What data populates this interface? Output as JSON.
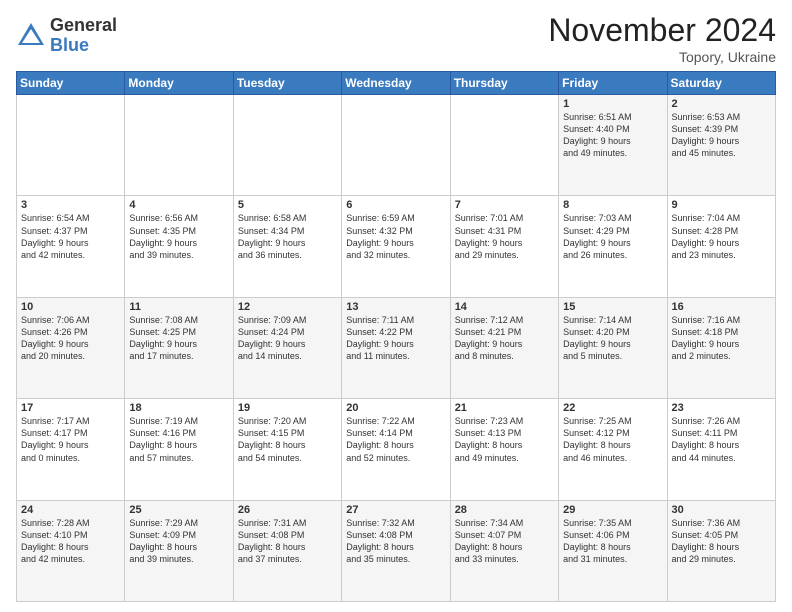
{
  "header": {
    "logo_general": "General",
    "logo_blue": "Blue",
    "month_title": "November 2024",
    "location": "Topory, Ukraine"
  },
  "weekdays": [
    "Sunday",
    "Monday",
    "Tuesday",
    "Wednesday",
    "Thursday",
    "Friday",
    "Saturday"
  ],
  "weeks": [
    [
      {
        "day": "",
        "detail": ""
      },
      {
        "day": "",
        "detail": ""
      },
      {
        "day": "",
        "detail": ""
      },
      {
        "day": "",
        "detail": ""
      },
      {
        "day": "",
        "detail": ""
      },
      {
        "day": "1",
        "detail": "Sunrise: 6:51 AM\nSunset: 4:40 PM\nDaylight: 9 hours\nand 49 minutes."
      },
      {
        "day": "2",
        "detail": "Sunrise: 6:53 AM\nSunset: 4:39 PM\nDaylight: 9 hours\nand 45 minutes."
      }
    ],
    [
      {
        "day": "3",
        "detail": "Sunrise: 6:54 AM\nSunset: 4:37 PM\nDaylight: 9 hours\nand 42 minutes."
      },
      {
        "day": "4",
        "detail": "Sunrise: 6:56 AM\nSunset: 4:35 PM\nDaylight: 9 hours\nand 39 minutes."
      },
      {
        "day": "5",
        "detail": "Sunrise: 6:58 AM\nSunset: 4:34 PM\nDaylight: 9 hours\nand 36 minutes."
      },
      {
        "day": "6",
        "detail": "Sunrise: 6:59 AM\nSunset: 4:32 PM\nDaylight: 9 hours\nand 32 minutes."
      },
      {
        "day": "7",
        "detail": "Sunrise: 7:01 AM\nSunset: 4:31 PM\nDaylight: 9 hours\nand 29 minutes."
      },
      {
        "day": "8",
        "detail": "Sunrise: 7:03 AM\nSunset: 4:29 PM\nDaylight: 9 hours\nand 26 minutes."
      },
      {
        "day": "9",
        "detail": "Sunrise: 7:04 AM\nSunset: 4:28 PM\nDaylight: 9 hours\nand 23 minutes."
      }
    ],
    [
      {
        "day": "10",
        "detail": "Sunrise: 7:06 AM\nSunset: 4:26 PM\nDaylight: 9 hours\nand 20 minutes."
      },
      {
        "day": "11",
        "detail": "Sunrise: 7:08 AM\nSunset: 4:25 PM\nDaylight: 9 hours\nand 17 minutes."
      },
      {
        "day": "12",
        "detail": "Sunrise: 7:09 AM\nSunset: 4:24 PM\nDaylight: 9 hours\nand 14 minutes."
      },
      {
        "day": "13",
        "detail": "Sunrise: 7:11 AM\nSunset: 4:22 PM\nDaylight: 9 hours\nand 11 minutes."
      },
      {
        "day": "14",
        "detail": "Sunrise: 7:12 AM\nSunset: 4:21 PM\nDaylight: 9 hours\nand 8 minutes."
      },
      {
        "day": "15",
        "detail": "Sunrise: 7:14 AM\nSunset: 4:20 PM\nDaylight: 9 hours\nand 5 minutes."
      },
      {
        "day": "16",
        "detail": "Sunrise: 7:16 AM\nSunset: 4:18 PM\nDaylight: 9 hours\nand 2 minutes."
      }
    ],
    [
      {
        "day": "17",
        "detail": "Sunrise: 7:17 AM\nSunset: 4:17 PM\nDaylight: 9 hours\nand 0 minutes."
      },
      {
        "day": "18",
        "detail": "Sunrise: 7:19 AM\nSunset: 4:16 PM\nDaylight: 8 hours\nand 57 minutes."
      },
      {
        "day": "19",
        "detail": "Sunrise: 7:20 AM\nSunset: 4:15 PM\nDaylight: 8 hours\nand 54 minutes."
      },
      {
        "day": "20",
        "detail": "Sunrise: 7:22 AM\nSunset: 4:14 PM\nDaylight: 8 hours\nand 52 minutes."
      },
      {
        "day": "21",
        "detail": "Sunrise: 7:23 AM\nSunset: 4:13 PM\nDaylight: 8 hours\nand 49 minutes."
      },
      {
        "day": "22",
        "detail": "Sunrise: 7:25 AM\nSunset: 4:12 PM\nDaylight: 8 hours\nand 46 minutes."
      },
      {
        "day": "23",
        "detail": "Sunrise: 7:26 AM\nSunset: 4:11 PM\nDaylight: 8 hours\nand 44 minutes."
      }
    ],
    [
      {
        "day": "24",
        "detail": "Sunrise: 7:28 AM\nSunset: 4:10 PM\nDaylight: 8 hours\nand 42 minutes."
      },
      {
        "day": "25",
        "detail": "Sunrise: 7:29 AM\nSunset: 4:09 PM\nDaylight: 8 hours\nand 39 minutes."
      },
      {
        "day": "26",
        "detail": "Sunrise: 7:31 AM\nSunset: 4:08 PM\nDaylight: 8 hours\nand 37 minutes."
      },
      {
        "day": "27",
        "detail": "Sunrise: 7:32 AM\nSunset: 4:08 PM\nDaylight: 8 hours\nand 35 minutes."
      },
      {
        "day": "28",
        "detail": "Sunrise: 7:34 AM\nSunset: 4:07 PM\nDaylight: 8 hours\nand 33 minutes."
      },
      {
        "day": "29",
        "detail": "Sunrise: 7:35 AM\nSunset: 4:06 PM\nDaylight: 8 hours\nand 31 minutes."
      },
      {
        "day": "30",
        "detail": "Sunrise: 7:36 AM\nSunset: 4:05 PM\nDaylight: 8 hours\nand 29 minutes."
      }
    ]
  ]
}
